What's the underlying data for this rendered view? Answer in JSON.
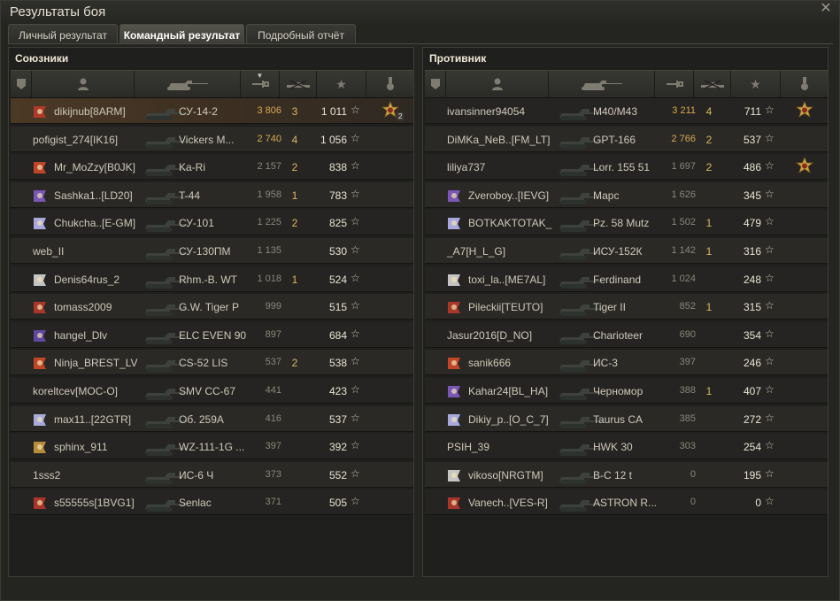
{
  "window": {
    "title": "Результаты боя"
  },
  "tabs": [
    {
      "label": "Личный результат"
    },
    {
      "label": "Командный результат"
    },
    {
      "label": "Подробный отчёт"
    }
  ],
  "allies": {
    "title": "Союзники",
    "rows": [
      {
        "player": "dikijnub[8ARM]",
        "tank": "СУ-14-2",
        "damage": "3 806",
        "kills": "3",
        "xp": "1 011",
        "medal": "orden-icon",
        "medal_count": "2",
        "me": true
      },
      {
        "player": "pofigist_274[IK16]",
        "tank": "Vickers M...",
        "damage": "2 740",
        "kills": "4",
        "xp": "1 056",
        "medal": "",
        "medal_count": ""
      },
      {
        "player": "Mr_MoZzy[B0JK]",
        "tank": "Ka-Ri",
        "damage": "2 157",
        "kills": "2",
        "xp": "838",
        "medal": "",
        "medal_count": ""
      },
      {
        "player": "Sashka1..[LD20]",
        "tank": "T-44",
        "damage": "1 958",
        "kills": "1",
        "xp": "783",
        "medal": "",
        "medal_count": ""
      },
      {
        "player": "Chukcha..[E-GM]",
        "tank": "СУ-101",
        "damage": "1 225",
        "kills": "2",
        "xp": "825",
        "medal": "",
        "medal_count": ""
      },
      {
        "player": "web_II",
        "tank": "СУ-130ПМ",
        "damage": "1 135",
        "kills": "",
        "xp": "530",
        "medal": "",
        "medal_count": ""
      },
      {
        "player": "Denis64rus_2",
        "tank": "Rhm.-B. WT",
        "damage": "1 018",
        "kills": "1",
        "xp": "524",
        "medal": "",
        "medal_count": ""
      },
      {
        "player": "tomass2009",
        "tank": "G.W. Tiger P",
        "damage": "999",
        "kills": "",
        "xp": "515",
        "medal": "",
        "medal_count": ""
      },
      {
        "player": "hangel_Dlv",
        "tank": "ELC EVEN 90",
        "damage": "897",
        "kills": "",
        "xp": "684",
        "medal": "",
        "medal_count": ""
      },
      {
        "player": "Ninja_BREST_LV",
        "tank": "CS-52 LIS",
        "damage": "537",
        "kills": "2",
        "xp": "538",
        "medal": "",
        "medal_count": ""
      },
      {
        "player": "koreltcev[MOC-O]",
        "tank": "SMV CC-67",
        "damage": "441",
        "kills": "",
        "xp": "423",
        "medal": "",
        "medal_count": ""
      },
      {
        "player": "max11..[22GTR]",
        "tank": "Об. 259А",
        "damage": "416",
        "kills": "",
        "xp": "537",
        "medal": "",
        "medal_count": ""
      },
      {
        "player": "sphinx_911",
        "tank": "WZ-111-1G ...",
        "damage": "397",
        "kills": "",
        "xp": "392",
        "medal": "",
        "medal_count": ""
      },
      {
        "player": "1sss2",
        "tank": "ИС-6 Ч",
        "damage": "373",
        "kills": "",
        "xp": "552",
        "medal": "",
        "medal_count": ""
      },
      {
        "player": "s55555s[1BVG1]",
        "tank": "Senlac",
        "damage": "371",
        "kills": "",
        "xp": "505",
        "medal": "",
        "medal_count": ""
      }
    ]
  },
  "enemies": {
    "title": "Противник",
    "rows": [
      {
        "player": "ivansinner94054",
        "tank": "M40/M43",
        "damage": "3 211",
        "kills": "4",
        "xp": "711",
        "medal": "orden-icon"
      },
      {
        "player": "DiMKa_NeB..[FM_LT]",
        "tank": "GPT-166",
        "damage": "2 766",
        "kills": "2",
        "xp": "537",
        "medal": ""
      },
      {
        "player": "liliya737",
        "tank": "Lorr. 155 51",
        "damage": "1 697",
        "kills": "2",
        "xp": "486",
        "medal": "orden-icon"
      },
      {
        "player": "Zveroboy..[IEVG]",
        "tank": "Марс",
        "damage": "1 626",
        "kills": "",
        "xp": "345",
        "medal": ""
      },
      {
        "player": "BOTKAKTOTAK_",
        "tank": "Pz. 58 Mutz",
        "damage": "1 502",
        "kills": "1",
        "xp": "479",
        "medal": ""
      },
      {
        "player": "_A7[H_L_G]",
        "tank": "ИСУ-152К",
        "damage": "1 142",
        "kills": "1",
        "xp": "316",
        "medal": ""
      },
      {
        "player": "toxi_la..[ME7AL]",
        "tank": "Ferdinand",
        "damage": "1 024",
        "kills": "",
        "xp": "248",
        "medal": ""
      },
      {
        "player": "Pileckii[TEUTO]",
        "tank": "Tiger II",
        "damage": "852",
        "kills": "1",
        "xp": "315",
        "medal": ""
      },
      {
        "player": "Jasur2016[D_NO]",
        "tank": "Charioteer",
        "damage": "690",
        "kills": "",
        "xp": "354",
        "medal": ""
      },
      {
        "player": "sanik666",
        "tank": "ИС-3",
        "damage": "397",
        "kills": "",
        "xp": "246",
        "medal": ""
      },
      {
        "player": "Kahar24[BL_HA]",
        "tank": "Черномор",
        "damage": "388",
        "kills": "1",
        "xp": "407",
        "medal": ""
      },
      {
        "player": "Dikiy_p..[O_C_7]",
        "tank": "Taurus CA",
        "damage": "385",
        "kills": "",
        "xp": "272",
        "medal": ""
      },
      {
        "player": "PSIH_39",
        "tank": "HWK 30",
        "damage": "303",
        "kills": "",
        "xp": "254",
        "medal": ""
      },
      {
        "player": "vikoso[NRGTM]",
        "tank": "B-C 12 t",
        "damage": "0",
        "kills": "",
        "xp": "195",
        "medal": ""
      },
      {
        "player": "Vanech..[VES-R]",
        "tank": "ASTRON R...",
        "damage": "0",
        "kills": "",
        "xp": "0",
        "medal": ""
      }
    ]
  },
  "xp_star": "☆",
  "colors": {
    "my_row": "#4b3925",
    "kills": "#d8b860",
    "damage_high": "#d8a850"
  }
}
